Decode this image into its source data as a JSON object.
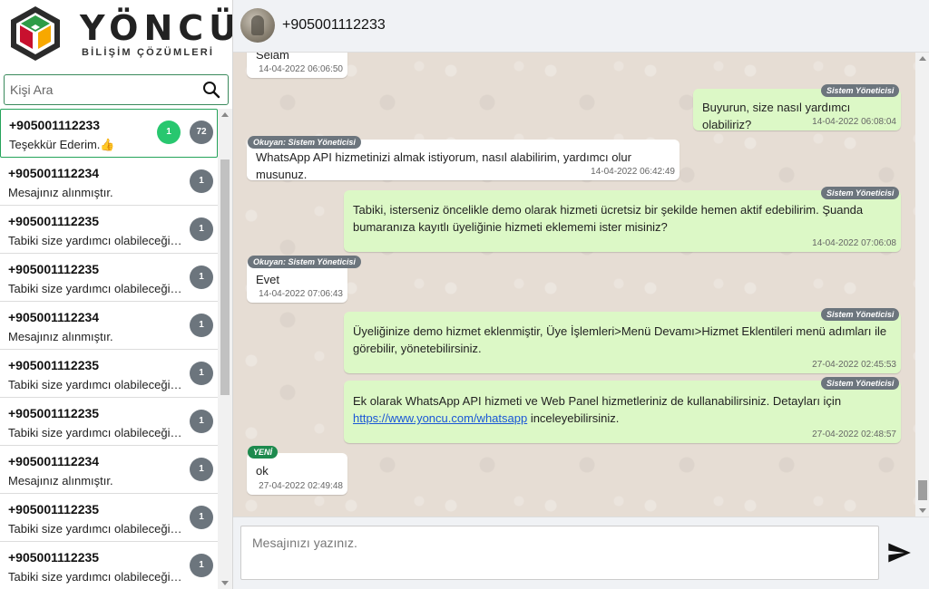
{
  "brand": {
    "name": "YÖNCÜ",
    "subtitle": "BİLİŞİM ÇÖZÜMLERİ"
  },
  "search": {
    "placeholder": "Kişi Ara",
    "value": ""
  },
  "contacts": [
    {
      "name": "+905001112233",
      "last_message": "Teşekkür Ederim.👍",
      "unread": "1",
      "count": "72",
      "active": true
    },
    {
      "name": "+905001112234",
      "last_message": "Mesajınız alınmıştır.",
      "count": "1"
    },
    {
      "name": "+905001112235",
      "last_message": "Tabiki size yardımcı olabileceğim f...",
      "count": "1"
    },
    {
      "name": "+905001112235",
      "last_message": "Tabiki size yardımcı olabileceğim f...",
      "count": "1"
    },
    {
      "name": "+905001112234",
      "last_message": "Mesajınız alınmıştır.",
      "count": "1"
    },
    {
      "name": "+905001112235",
      "last_message": "Tabiki size yardımcı olabileceğim f...",
      "count": "1"
    },
    {
      "name": "+905001112235",
      "last_message": "Tabiki size yardımcı olabileceğim f...",
      "count": "1"
    },
    {
      "name": "+905001112234",
      "last_message": "Mesajınız alınmıştır.",
      "count": "1"
    },
    {
      "name": "+905001112235",
      "last_message": "Tabiki size yardımcı olabileceğim f...",
      "count": "1"
    },
    {
      "name": "+905001112235",
      "last_message": "Tabiki size yardımcı olabileceğim f...",
      "count": "1"
    }
  ],
  "chat": {
    "title": "+905001112233",
    "messages": [
      {
        "direction": "in",
        "text": "Selam",
        "time": "14-04-2022 06:06:50"
      },
      {
        "direction": "out",
        "tag": "Sistem Yöneticisi",
        "text": "Buyurun, size nasıl yardımcı olabiliriz?",
        "time": "14-04-2022 06:08:04"
      },
      {
        "direction": "in",
        "tag": "Okuyan: Sistem Yöneticisi",
        "text": "WhatsApp API hizmetinizi almak istiyorum, nasıl alabilirim, yardımcı olur musunuz.",
        "time": "14-04-2022 06:42:49"
      },
      {
        "direction": "out",
        "tag": "Sistem Yöneticisi",
        "text_line1": "Tabiki, isterseniz öncelikle demo olarak hizmeti ücretsiz bir şekilde hemen aktif edebilirim. Şuanda",
        "text_line2": "bumaranıza kayıtlı üyeliğinie hizmeti eklememi ister misiniz?",
        "time": "14-04-2022 07:06:08"
      },
      {
        "direction": "in",
        "tag": "Okuyan: Sistem Yöneticisi",
        "text": "Evet",
        "time": "14-04-2022 07:06:43"
      },
      {
        "direction": "out",
        "tag": "Sistem Yöneticisi",
        "text_line1": "Üyeliğinize demo hizmet eklenmiştir, Üye İşlemleri>Menü Devamı>Hizmet Eklentileri menü adımları ile",
        "text_line2": "görebilir, yönetebilirsiniz.",
        "time": "27-04-2022 02:45:53"
      },
      {
        "direction": "out",
        "tag": "Sistem Yöneticisi",
        "text_line1": "Ek olarak WhatsApp API hizmeti ve Web Panel hizmetleriniz de kullanabilirsiniz. Detayları için",
        "link": "https://www.yoncu.com/whatsapp",
        "text_after_link": " inceleyebilirsiniz.",
        "time": "27-04-2022 02:48:57"
      },
      {
        "direction": "in",
        "tag": "YENİ",
        "text": "ok",
        "time": "27-04-2022 02:49:48"
      }
    ]
  },
  "composer": {
    "placeholder": "Mesajınızı yazınız.",
    "value": ""
  },
  "colors": {
    "accent": "#25a35a",
    "out_bubble": "#dcf8c6",
    "tag_gray": "#6c757d",
    "tag_new": "#1d8a4e",
    "unread": "#28c76f"
  },
  "icons": {
    "search": "search-icon",
    "send": "send-icon",
    "logo": "yoncu-logo-icon"
  }
}
